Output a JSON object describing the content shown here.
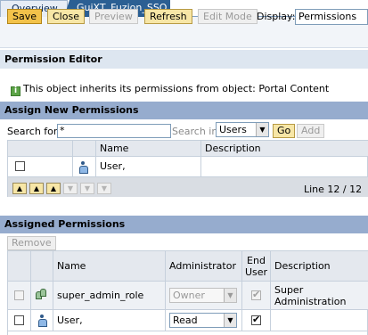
{
  "tabs": [
    {
      "label": "Overview",
      "active": false
    },
    {
      "label": "GuiXT_Fuzion_SSO",
      "active": true
    }
  ],
  "toolbar": {
    "save": "Save",
    "close": "Close",
    "preview": "Preview",
    "refresh": "Refresh",
    "edit_mode": "Edit Mode",
    "display_label": "Display:",
    "display_value": "Permissions"
  },
  "editor": {
    "title": "Permission Editor",
    "info_text": "This object inherits its permissions from object: Portal Content"
  },
  "assign_new": {
    "title": "Assign New Permissions",
    "search_for_label": "Search for",
    "search_value": "*",
    "search_in_label": "Search in",
    "search_in_value": "Users",
    "go": "Go",
    "add": "Add",
    "columns": {
      "name": "Name",
      "description": "Description"
    },
    "rows": [
      {
        "name": "User,",
        "description": ""
      }
    ],
    "pager_text": "Line 12 / 12"
  },
  "assigned": {
    "title": "Assigned Permissions",
    "remove": "Remove",
    "columns": {
      "name": "Name",
      "administrator": "Administrator",
      "end_user": "End User",
      "description": "Description"
    },
    "rows": [
      {
        "name": "super_admin_role",
        "administrator": "Owner",
        "end_user": true,
        "description": "Super Administration",
        "type": "role"
      },
      {
        "name": "User,",
        "administrator": "Read",
        "end_user": true,
        "description": "",
        "type": "user"
      }
    ]
  },
  "colors": {
    "accent": "#2b5f93",
    "button": "#f7e6a6",
    "section": "#96acce"
  }
}
